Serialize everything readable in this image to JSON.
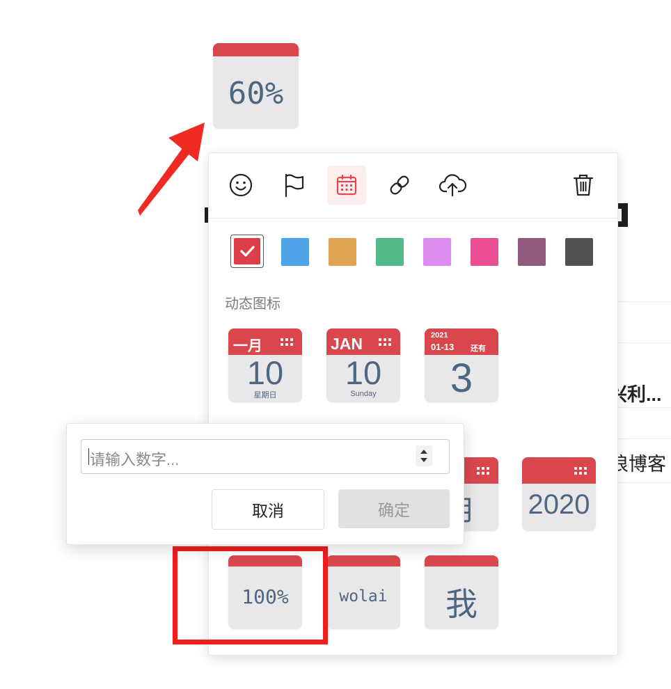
{
  "preview_icon": {
    "label": "60%"
  },
  "background_page": {
    "text_1": "兴利...",
    "text_2": "浪博客"
  },
  "toolbar": {
    "emoji": "smile-icon",
    "flag": "flag-icon",
    "calendar": "calendar-icon",
    "link": "link-icon",
    "upload": "cloud-upload-icon",
    "delete": "trash-icon"
  },
  "colors": [
    "#dc3f45",
    "#4fa3e8",
    "#e0a452",
    "#52b98b",
    "#dc8cf1",
    "#ec4e93",
    "#8f5a7e",
    "#515151"
  ],
  "dynamic_section": {
    "title": "动态图标",
    "icons": [
      {
        "top_label": "一月",
        "big": "10",
        "sub": "星期日"
      },
      {
        "top_label": "JAN",
        "big": "10",
        "sub": "Sunday"
      },
      {
        "year": "2021",
        "date": "01-13",
        "tag": "还有",
        "big": "3"
      }
    ]
  },
  "row2_icons": [
    {
      "big": "月"
    },
    {
      "big": "2020"
    }
  ],
  "row3_icons": [
    {
      "big": "100%"
    },
    {
      "big": "wolai"
    },
    {
      "big": "我"
    }
  ],
  "number_popup": {
    "placeholder": "请输入数字...",
    "cancel_label": "取消",
    "confirm_label": "确定"
  }
}
